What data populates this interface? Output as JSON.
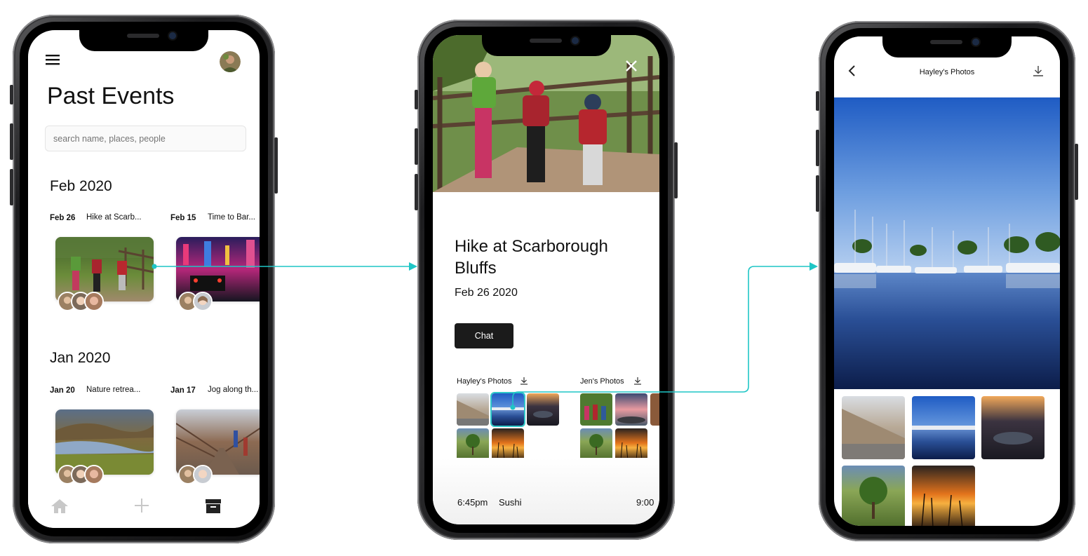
{
  "colors": {
    "accent": "#1fc6c6",
    "button": "#1b1b1b"
  },
  "events_screen": {
    "menu_icon": "hamburger-menu-icon",
    "title": "Past Events",
    "search": {
      "placeholder": "search name, places, people"
    },
    "months": [
      {
        "label": "Feb 2020",
        "events": [
          {
            "date": "Feb 26",
            "name": "Hike at Scarb..."
          },
          {
            "date": "Feb 15",
            "name": "Time to Bar..."
          }
        ]
      },
      {
        "label": "Jan 2020",
        "events": [
          {
            "date": "Jan 20",
            "name": "Nature retrea..."
          },
          {
            "date": "Jan 17",
            "name": "Jog along th..."
          }
        ]
      }
    ],
    "tabbar": [
      "home-icon",
      "add-icon",
      "archive-icon"
    ]
  },
  "event_detail": {
    "close_icon": "close-icon",
    "title": "Hike at Scarborough Bluffs",
    "date": "Feb 26 2020",
    "chat_label": "Chat",
    "galleries": [
      {
        "label": "Hayley's Photos",
        "icon": "download-icon"
      },
      {
        "label": "Jen's Photos",
        "icon": "download-icon"
      }
    ],
    "timeline": [
      {
        "time": "6:45pm",
        "place": "Sushi"
      },
      {
        "time": "9:00",
        "place": ""
      }
    ]
  },
  "photo_viewer": {
    "back_icon": "chevron-left-icon",
    "title": "Hayley's Photos",
    "download_icon": "download-icon"
  }
}
